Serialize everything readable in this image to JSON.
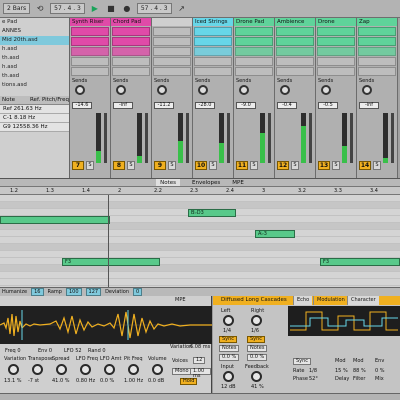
{
  "topbar": {
    "zoom": "2 Bars",
    "position": "57 . 4 . 3",
    "loop_start": "57 . 4 . 3"
  },
  "browser": {
    "items": [
      "e Pad",
      "ANNES",
      "Mid 20th.asd",
      "h.asd",
      "th.asd",
      "h.asd",
      "th.asd",
      "tions.asd"
    ],
    "selected_index": 2,
    "header_a": "Note",
    "header_b": "Ref. Pitch/Freq",
    "val_1": "261.63 Hz",
    "val_2": "8.18 Hz",
    "val_3": "12558.36 Hz",
    "labels": [
      "Ref",
      "C-1",
      "G9"
    ]
  },
  "tracks": [
    {
      "name": "Synth Riser",
      "color": "#e04aa8",
      "vol": "-14.6",
      "num": "7",
      "meter": 0.25
    },
    {
      "name": "Chord Pad",
      "color": "#e04aa8",
      "vol": "-inf",
      "num": "8",
      "meter": 0.15
    },
    {
      "name": "",
      "color": "#cfcfcf",
      "vol": "-11.2",
      "num": "9",
      "meter": 0.45
    },
    {
      "name": "Iced Strings",
      "color": "#67d6e8",
      "vol": "-28.0",
      "num": "10",
      "meter": 0.4
    },
    {
      "name": "Drone Pad",
      "color": "#5fd39a",
      "vol": "-9.0",
      "num": "11",
      "meter": 0.6
    },
    {
      "name": "Ambience",
      "color": "#5fd39a",
      "vol": "-0.4",
      "num": "12",
      "meter": 0.75
    },
    {
      "name": "Drone",
      "color": "#5fd39a",
      "vol": "-0.5",
      "num": "13",
      "meter": 0.35
    },
    {
      "name": "Zap",
      "color": "#5fd39a",
      "vol": "-inf",
      "num": "14",
      "meter": 0.1
    }
  ],
  "sends_label": "Sends",
  "editor": {
    "tabs": [
      "Notes",
      "Envelopes",
      "MPE"
    ],
    "active_tab": 0,
    "ruler": [
      "1.2",
      "1.3",
      "1.4",
      "2",
      "2.2",
      "2.3",
      "2.4",
      "3",
      "3.2",
      "3.3",
      "3.4"
    ],
    "notes": [
      {
        "label": "",
        "row": 3,
        "start": 0,
        "len": 110
      },
      {
        "label": "B♭D3",
        "row": 2,
        "start": 188,
        "len": 48
      },
      {
        "label": "A♭3",
        "row": 5,
        "start": 255,
        "len": 40
      },
      {
        "label": "F3",
        "row": 9,
        "start": 62,
        "len": 98
      },
      {
        "label": "F3",
        "row": 9,
        "start": 320,
        "len": 80
      }
    ],
    "noteinfo": {
      "a": "Humanize",
      "b": "16",
      "c": "Ramp",
      "d": "100",
      "e": "127",
      "f": "Deviation",
      "g": "0"
    }
  },
  "sampler": {
    "mpe": "MPE",
    "params": [
      {
        "label": "Variation",
        "value": "13.1 %"
      },
      {
        "label": "Transpose",
        "value": "-7 st"
      },
      {
        "label": "Spread",
        "value": "41.0 %"
      },
      {
        "label": "LFO Freq",
        "value": "0.80 Hz"
      },
      {
        "label": "LFO Amt",
        "value": "0.0 %"
      },
      {
        "label": "Pit Freq",
        "value": "1.00 Hz"
      },
      {
        "label": "Volume",
        "value": "0.0 dB"
      }
    ],
    "variation_label": "Variation",
    "variation_value": "6.08 ms",
    "voices_label": "Voices",
    "voices_value": "12",
    "mono": "Mono",
    "hold": "Hold",
    "glide": "1.00 ms",
    "freq_label": "Freq",
    "freq_value": "0",
    "env_label": "Env",
    "env_value": "0",
    "lfo_label": "LFO",
    "lfo_value": "52",
    "rand_label": "Rand",
    "rand_value": "0"
  },
  "synth": {
    "title": "Diffused Long Cascades",
    "tabs": [
      "Echo",
      "Modulation",
      "Character"
    ],
    "active_tab": 1,
    "left_label": "Left",
    "right_label": "Right",
    "left_val": "1/4",
    "right_val": "1/6",
    "sync": "Sync",
    "notes_label": "Notes",
    "offset": "0.0 %",
    "input_label": "Input",
    "input_val": "12 dB",
    "feedback_label": "Feedback",
    "feedback_val": "41 %",
    "rate_label": "Rate",
    "rate_val": "1/8",
    "phase_label": "Phase",
    "phase_val": "52°",
    "mod_label": "Mod",
    "mod_val": "15 %",
    "mod2_val": "88 %",
    "env_label": "Env",
    "env_val": "0 %",
    "delay_label": "Delay",
    "filter_label": "Filter",
    "mix_label": "Mix"
  }
}
